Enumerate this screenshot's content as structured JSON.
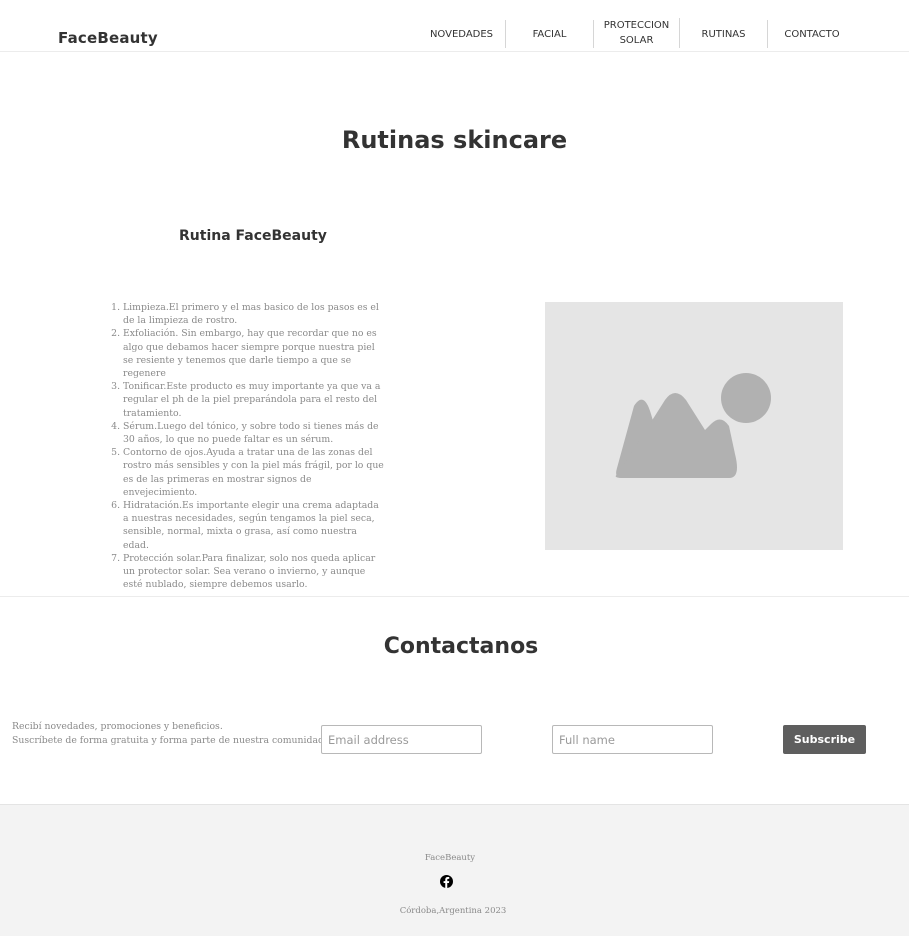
{
  "header": {
    "brand": "FaceBeauty",
    "nav": [
      {
        "label": "NOVEDADES"
      },
      {
        "label": "FACIAL"
      },
      {
        "label": "PROTECCION\nSOLAR"
      },
      {
        "label": "RUTINAS"
      },
      {
        "label": "CONTACTO"
      }
    ]
  },
  "main": {
    "title": "Rutinas skincare",
    "section_heading": "Rutina FaceBeauty",
    "steps": [
      "Limpieza.El primero y el mas basico de los pasos es el de la limpieza de rostro.",
      "Exfoliación. Sin embargo, hay que recordar que no es algo que debamos hacer siempre porque nuestra piel se resiente y tenemos que darle tiempo a que se regenere",
      "Tonificar.Este producto es muy importante ya que va a regular el ph de la piel preparándola para el resto del tratamiento.",
      "Sérum.Luego del tónico, y sobre todo si tienes más de 30 años, lo que no puede faltar es un sérum.",
      "Contorno de ojos.Ayuda a tratar una de las zonas del rostro más sensibles y con la piel más frágil, por lo que es de las primeras en mostrar signos de envejecimiento.",
      "Hidratación.Es importante elegir una crema adaptada a nuestras necesidades, según tengamos la piel seca, sensible, normal, mixta o grasa, así como nuestra edad.",
      "Protección solar.Para finalizar, solo nos queda aplicar un protector solar. Sea verano o invierno, y aunque esté nublado, siempre debemos usarlo."
    ],
    "image_icon": "image-placeholder-icon"
  },
  "contact": {
    "title": "Contactanos",
    "promo_line1": "Recibí novedades, promociones y beneficios.",
    "promo_line2": "Suscríbete de forma gratuita y forma parte de nuestra comunidad.",
    "email_placeholder": "Email address",
    "name_placeholder": "Full name",
    "subscribe_label": "Subscribe"
  },
  "footer": {
    "brand": "FaceBeauty",
    "social_icon": "facebook-icon",
    "location": "Córdoba,Argentina 2023"
  },
  "colors": {
    "text": "#333333",
    "muted": "#8a8a8a",
    "button": "#5e5e5e",
    "placeholder_bg": "#e5e5e5",
    "placeholder_shape": "#b1b1b1",
    "footer_bg": "#f3f3f3"
  }
}
